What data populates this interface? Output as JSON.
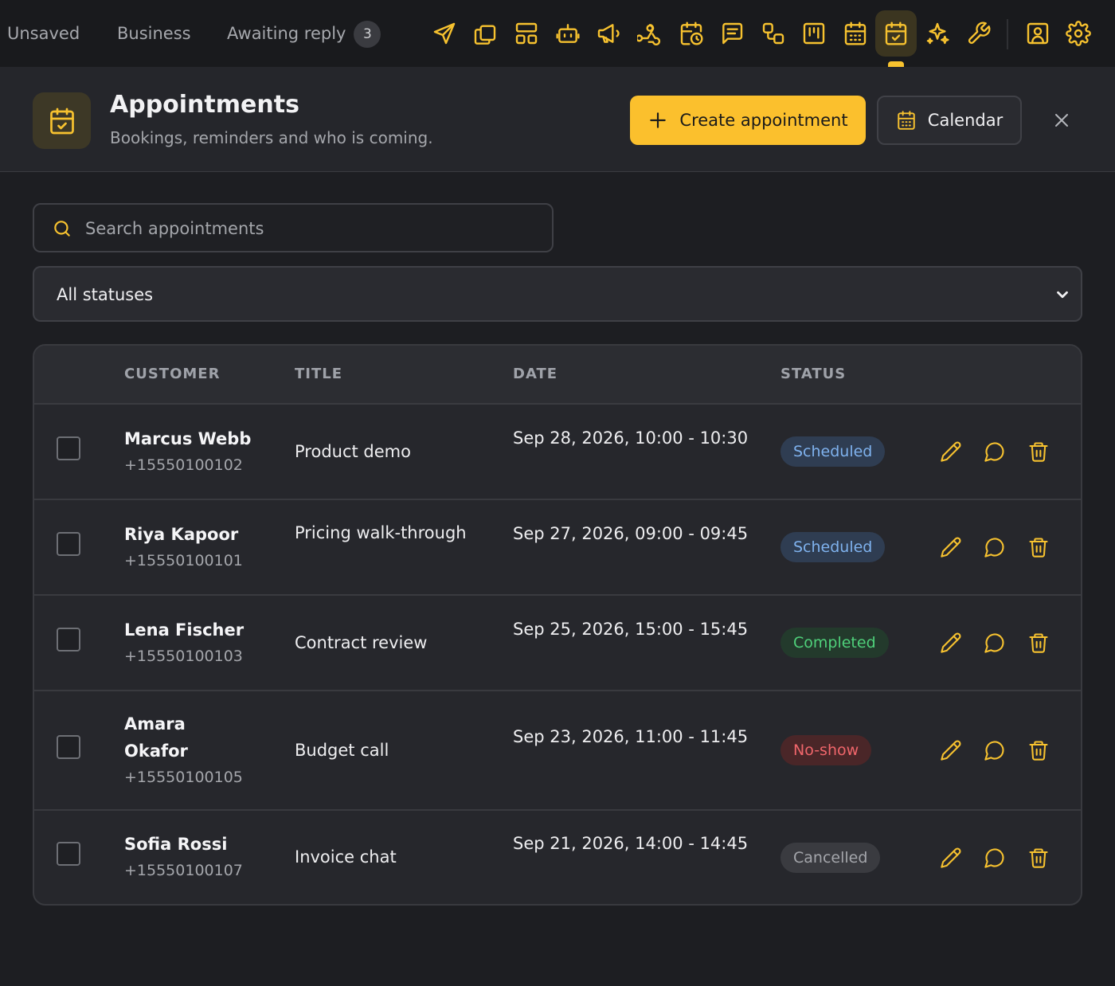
{
  "topbar": {
    "tabs": [
      {
        "label": "Unsaved"
      },
      {
        "label": "Business"
      },
      {
        "label": "Awaiting reply",
        "count": "3"
      }
    ],
    "icons": [
      "send-icon",
      "copy-icon",
      "layout-icon",
      "bot-icon",
      "megaphone-icon",
      "webhook-icon",
      "calendar-clock-icon",
      "message-square-icon",
      "workflow-icon",
      "kanban-icon",
      "calendar-grid-icon",
      "calendar-check-icon",
      "sparkles-icon",
      "wrench-icon",
      "contact-icon",
      "settings-icon"
    ],
    "active_icon": "calendar-check-icon"
  },
  "header": {
    "title": "Appointments",
    "subtitle": "Bookings, reminders and who is coming.",
    "create_label": "Create appointment",
    "calendar_label": "Calendar"
  },
  "search": {
    "placeholder": "Search appointments"
  },
  "filter": {
    "selected": "All statuses"
  },
  "table": {
    "columns": {
      "customer": "CUSTOMER",
      "title": "TITLE",
      "date": "DATE",
      "status": "STATUS"
    },
    "rows": [
      {
        "name": "Marcus Webb",
        "phone": "+15550100102",
        "title": "Product demo",
        "date": "Sep 28, 2026, 10:00 - 10:30",
        "status": "Scheduled"
      },
      {
        "name": "Riya Kapoor",
        "phone": "+15550100101",
        "title": "Pricing walk-through",
        "date": "Sep 27, 2026, 09:00 - 09:45",
        "status": "Scheduled"
      },
      {
        "name": "Lena Fischer",
        "phone": "+15550100103",
        "title": "Contract review",
        "date": "Sep 25, 2026, 15:00 - 15:45",
        "status": "Completed"
      },
      {
        "name": "Amara Okafor",
        "phone": "+15550100105",
        "title": "Budget call",
        "date": "Sep 23, 2026, 11:00 - 11:45",
        "status": "No-show"
      },
      {
        "name": "Sofia Rossi",
        "phone": "+15550100107",
        "title": "Invoice chat",
        "date": "Sep 21, 2026, 14:00 - 14:45",
        "status": "Cancelled"
      }
    ]
  },
  "colors": {
    "accent": "#fbc02d",
    "scheduled_bg": "#2f3d52",
    "scheduled_fg": "#7fb2ee",
    "completed_bg": "#233a2c",
    "completed_fg": "#4fd07a",
    "noshow_bg": "#4a2628",
    "noshow_fg": "#f0666b",
    "cancelled_bg": "#3a3b40",
    "cancelled_fg": "#a4a6ab"
  }
}
